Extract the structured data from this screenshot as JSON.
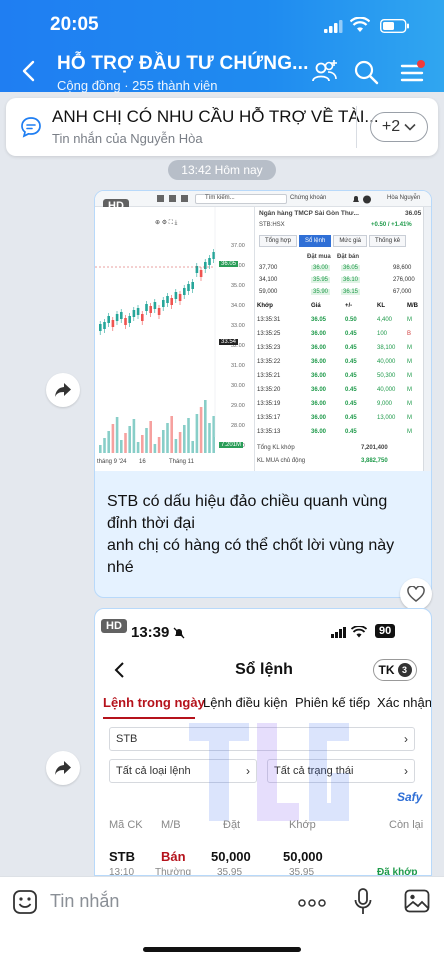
{
  "status_bar": {
    "time": "20:05"
  },
  "header": {
    "title": "HỖ TRỢ ĐẦU TƯ CHỨNG...",
    "subtitle": "Cộng đồng · 255 thành viên",
    "icons": [
      "back-arrow-icon",
      "group-add-icon",
      "search-icon",
      "menu-icon"
    ]
  },
  "pinned": {
    "title": "ANH CHỊ CÓ NHU CẦU HỖ TRỢ VỀ TÀI...",
    "subtitle": "Tin nhắn của Nguyễn Hòa",
    "more_label": "+2"
  },
  "time_divider": "13:42 Hôm nay",
  "message1": {
    "badge": "HD",
    "image": {
      "search_placeholder": "Tìm kiếm...",
      "market_label": "Chứng khoán",
      "user_name": "Hòa Nguyễn",
      "bank_name": "Ngân hàng TMCP Sài Gòn Thư...",
      "price": "36.05",
      "ticker": "STB:HSX",
      "change": "+0.50 / +1.41%",
      "tabs": [
        "Tổng hợp",
        "Sổ lệnh",
        "Mức giá",
        "Thống kê"
      ],
      "book_headers": [
        "Đặt mua",
        "Đặt bán"
      ],
      "book_rows": [
        [
          "37,700",
          "36.00",
          "36.05",
          "98,600"
        ],
        [
          "34,100",
          "35.95",
          "36.10",
          "276,000"
        ],
        [
          "59,000",
          "35.90",
          "36.15",
          "67,000"
        ]
      ],
      "match_headers": [
        "Khớp",
        "Giá",
        "+/-",
        "KL",
        "M/B"
      ],
      "match_rows": [
        [
          "13:35:31",
          "36.05",
          "0.50",
          "4,400",
          "M"
        ],
        [
          "13:35:25",
          "36.00",
          "0.45",
          "100",
          "B"
        ],
        [
          "13:35:23",
          "36.00",
          "0.45",
          "38,100",
          "M"
        ],
        [
          "13:35:22",
          "36.00",
          "0.45",
          "40,000",
          "M"
        ],
        [
          "13:35:21",
          "36.00",
          "0.45",
          "50,300",
          "M"
        ],
        [
          "13:35:20",
          "36.00",
          "0.45",
          "40,000",
          "M"
        ],
        [
          "13:35:19",
          "36.00",
          "0.45",
          "9,000",
          "M"
        ],
        [
          "13:35:17",
          "36.00",
          "0.45",
          "13,000",
          "M"
        ],
        [
          "13:35:13",
          "36.00",
          "0.45",
          "",
          "M"
        ]
      ],
      "total_label": "Tổng KL khớp",
      "total_value": "7,201,400",
      "kl_mua_label": "KL MUA chủ động",
      "kl_mua_value": "3,882,750",
      "axis_prices": [
        "37.00",
        "36.00",
        "35.00",
        "34.00",
        "33.00",
        "32.00",
        "31.00",
        "30.00",
        "29.00",
        "28.00",
        "27.00"
      ],
      "last_price_tag": "36.05",
      "prev_tag": "33.54",
      "vol_tag": "7.201M",
      "x_labels": [
        "tháng 9 '24",
        "16",
        "Tháng 11"
      ],
      "side_tabs": [
        "Danh",
        "Thông tin",
        "Watchlist",
        "Bài viết",
        "Công đồng",
        "Cảnh báo",
        "Kiến thức"
      ]
    },
    "text_lines": [
      "STB có dấu hiệu đảo chiều quanh vùng",
      "đỉnh thời đại",
      "anh chị có hàng có thể chốt lời vùng này",
      "nhé"
    ]
  },
  "message2": {
    "badge": "HD",
    "phone_time": "13:39",
    "battery": "90",
    "title": "Sổ lệnh",
    "tk_label": "TK",
    "tk_num": "3",
    "tabs": [
      "Lệnh trong ngày",
      "Lệnh điều kiện",
      "Phiên kế tiếp",
      "Xác nhận lệ"
    ],
    "field_symbol": "STB",
    "field_order_type": "Tất cả loại lệnh",
    "field_status": "Tất cả trạng thái",
    "brand": "Safy",
    "col_headers": [
      "Mã CK",
      "M/B",
      "Đặt",
      "Khớp",
      "Còn lại"
    ],
    "row": {
      "symbol": "STB",
      "side": "Bán",
      "order_qty": "50,000",
      "match_qty": "50,000",
      "time": "13:10",
      "type": "Thường",
      "order_price": "35.95",
      "match_price": "35.95",
      "status": "Đã khớp"
    }
  },
  "input": {
    "placeholder": "Tin nhắn"
  },
  "colors": {
    "header": "#1f7ef2",
    "bubble": "#e5f2ff",
    "sell": "#b5121b",
    "accent": "#2f6fd6"
  }
}
